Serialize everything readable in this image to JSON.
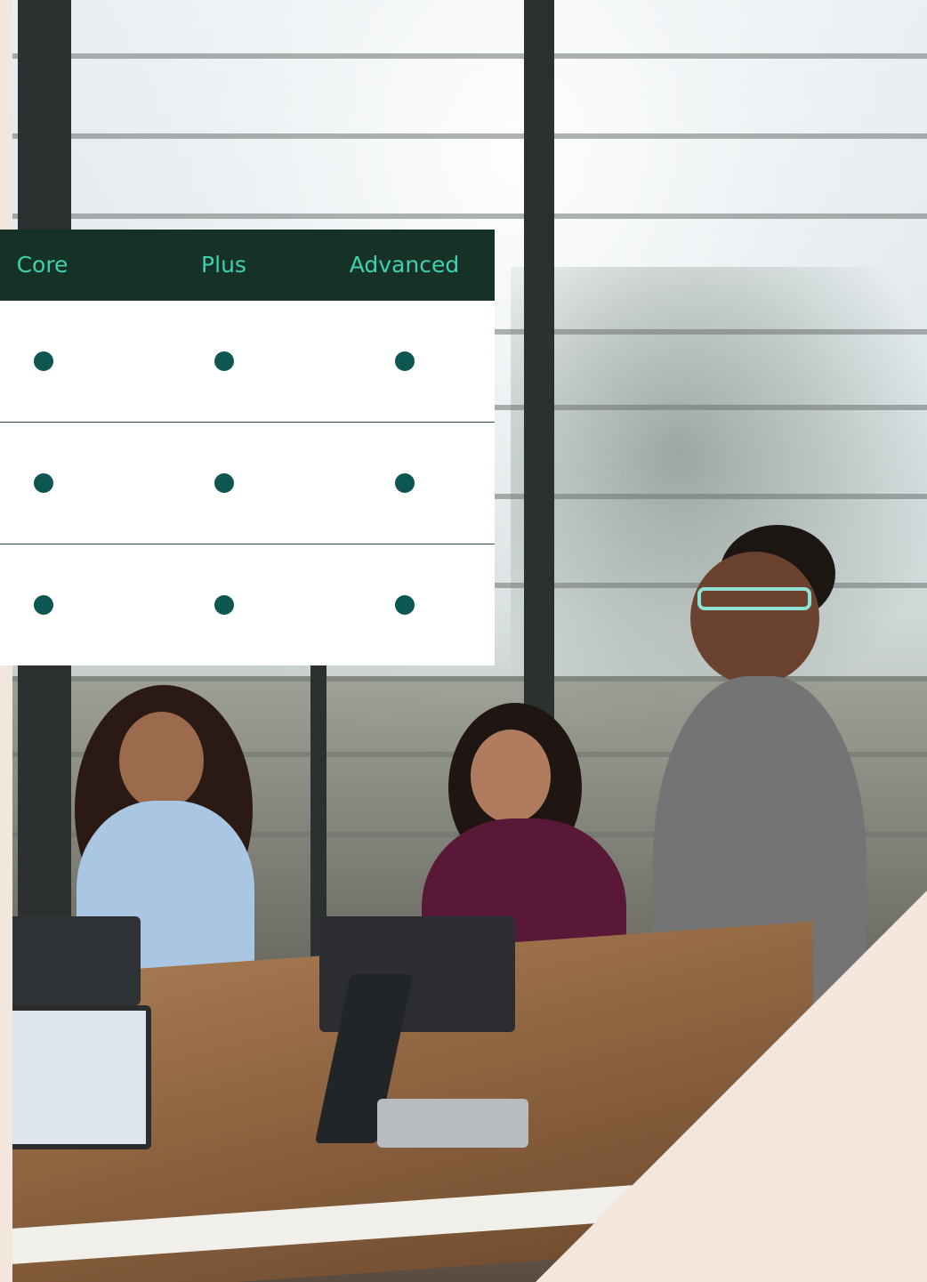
{
  "plans_table": {
    "columns": [
      {
        "label": "Core"
      },
      {
        "label": "Plus"
      },
      {
        "label": "Advanced"
      }
    ],
    "rows": [
      {
        "core": true,
        "plus": true,
        "advanced": true
      },
      {
        "core": true,
        "plus": true,
        "advanced": true
      },
      {
        "core": true,
        "plus": true,
        "advanced": true
      }
    ]
  },
  "colors": {
    "header_background": "#163126",
    "header_text": "#3fd1b0",
    "dot": "#0d5652",
    "divider": "#2e4a44",
    "page_background": "#f2e6dd",
    "table_background": "#ffffff"
  },
  "photo": {
    "subject": "meeting-photo"
  }
}
